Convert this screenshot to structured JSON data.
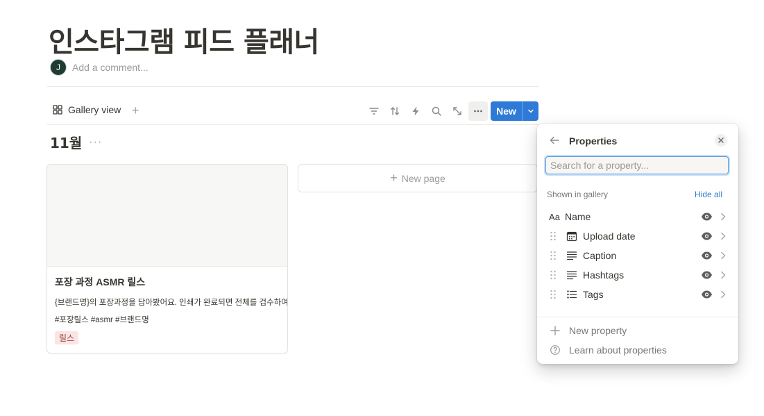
{
  "page": {
    "title": "인스타그램 피드 플래너",
    "avatar_initial": "J",
    "comment_placeholder": "Add a comment..."
  },
  "viewbar": {
    "view_label": "Gallery view",
    "add_view": "+",
    "new_label": "New",
    "more_label": "···"
  },
  "group": {
    "title": "11월",
    "more": "···"
  },
  "cards": [
    {
      "title": "포장 과정 ASMR 릴스",
      "caption": "{브랜드명}의 포장과정을 담아봤어요. 인쇄가 완료되면 전체를 검수하여",
      "hashtags": "#포장릴스 #asmr #브랜드명",
      "tag": "릴스"
    }
  ],
  "new_page": {
    "plus": "+",
    "label": "New page"
  },
  "properties_panel": {
    "title": "Properties",
    "search_placeholder": "Search for a property...",
    "section_label": "Shown in gallery",
    "hide_all": "Hide all",
    "name_type_label": "Aa",
    "items": [
      {
        "name": "Name",
        "icon": "text-type-icon"
      },
      {
        "name": "Upload date",
        "icon": "calendar-icon"
      },
      {
        "name": "Caption",
        "icon": "text-lines-icon"
      },
      {
        "name": "Hashtags",
        "icon": "text-lines-icon"
      },
      {
        "name": "Tags",
        "icon": "multi-select-icon"
      }
    ],
    "footer": {
      "new_property": "New property",
      "learn": "Learn about properties"
    }
  },
  "colors": {
    "accent": "#2f7ad7",
    "tag_bg": "#fbe4e4",
    "tag_text": "#93413b",
    "avatar_bg": "#1f3c33"
  }
}
